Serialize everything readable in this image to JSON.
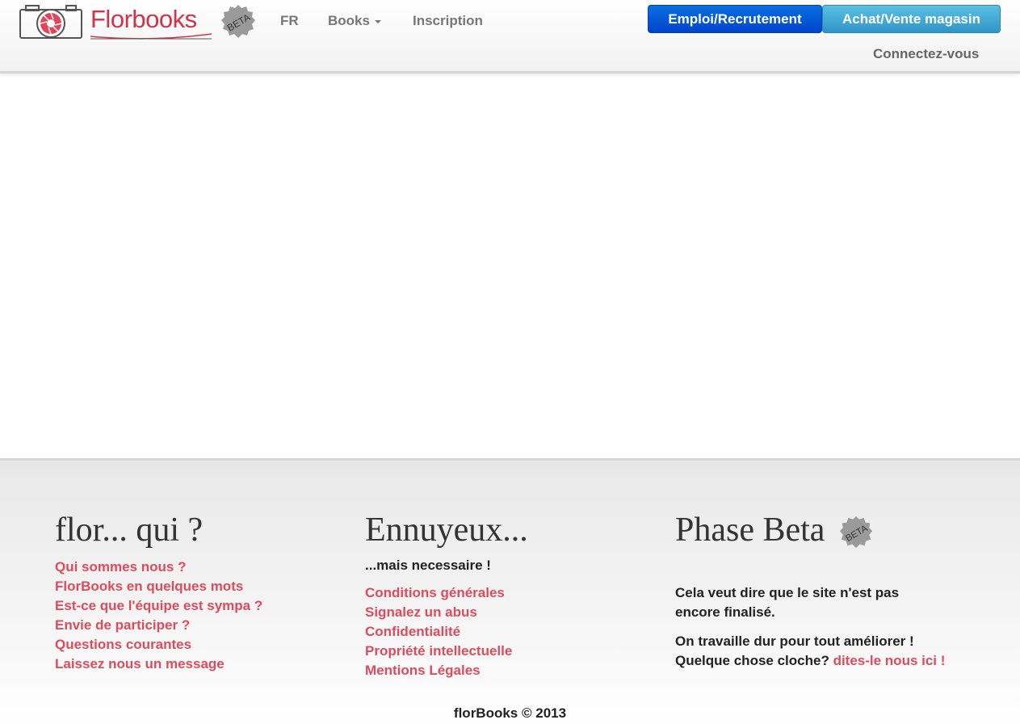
{
  "header": {
    "logo_text": "Florbooks",
    "beta": "BETA",
    "nav": {
      "lang": "FR",
      "books": "Books",
      "signup": "Inscription"
    },
    "buttons": {
      "jobs": "Emploi/Recrutement",
      "shop": "Achat/Vente magasin"
    },
    "login": "Connectez-vous"
  },
  "footer": {
    "col1": {
      "title": "flor... qui ?",
      "links": [
        "Qui sommes nous ?",
        "FlorBooks en quelques mots",
        "Est-ce que l'équipe est sympa ?",
        "Envie de participer ?",
        "Questions courantes",
        "Laissez nous un message"
      ]
    },
    "col2": {
      "title": "Ennuyeux...",
      "subtitle": "...mais necessaire !",
      "links": [
        "Conditions générales",
        "Signalez un abus",
        "Confidentialité",
        "Propriété intellectuelle",
        "Mentions Légales"
      ]
    },
    "col3": {
      "title": "Phase Beta",
      "beta": "BETA",
      "p1": "Cela veut dire que le site n'est pas encore finalisé.",
      "p2_line1": "On travaille dur pour tout améliorer !",
      "p2_line2": "Quelque chose cloche?",
      "p2_link": "dites-le nous ici !"
    },
    "copyright": "florBooks © 2013"
  },
  "colors": {
    "accent": "#dc4c5c",
    "primary_button": "#0044cc",
    "info_button": "#2f95c7"
  }
}
